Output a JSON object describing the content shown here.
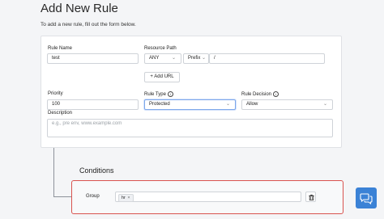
{
  "header": {
    "title": "Add New Rule",
    "subtitle": "To add a new rule, fill out the form below."
  },
  "form": {
    "rule_name": {
      "label": "Rule Name",
      "value": "test"
    },
    "resource_path": {
      "label": "Resource Path",
      "method": "ANY",
      "match_type": "Prefix",
      "path": "/",
      "add_url_label": "+ Add URL"
    },
    "priority": {
      "label": "Priority",
      "value": "100"
    },
    "rule_type": {
      "label": "Rule Type",
      "value": "Protected"
    },
    "rule_decision": {
      "label": "Rule Decision",
      "value": "Allow"
    },
    "description": {
      "label": "Description",
      "placeholder": "e.g., pre env, www.example.com"
    }
  },
  "conditions": {
    "title": "Conditions",
    "group_label": "Group",
    "tags": [
      "hr"
    ],
    "tag_remove_glyph": "×"
  },
  "icons": {
    "info": "info-icon",
    "chevron": "chevron-down-icon",
    "trash": "trash-icon",
    "chat": "chat-icon"
  },
  "colors": {
    "accent": "#3b82d6",
    "highlight_border": "#d9534f"
  }
}
